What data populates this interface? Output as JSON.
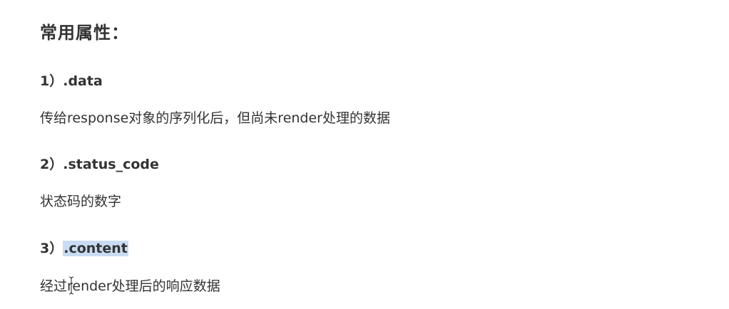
{
  "document": {
    "title": "常用属性：",
    "sections": [
      {
        "number": "1）",
        "name": ".data",
        "description": "传给response对象的序列化后，但尚未render处理的数据"
      },
      {
        "number": "2）",
        "name": ".status_code",
        "description": "状态码的数字"
      },
      {
        "number": "3）",
        "name": ".content",
        "description": "经过render处理后的响应数据"
      }
    ]
  },
  "colors": {
    "text": "#333333",
    "selection_highlight": "#c9dcf3"
  },
  "icons": {
    "text_cursor": "i-beam-cursor-icon"
  }
}
